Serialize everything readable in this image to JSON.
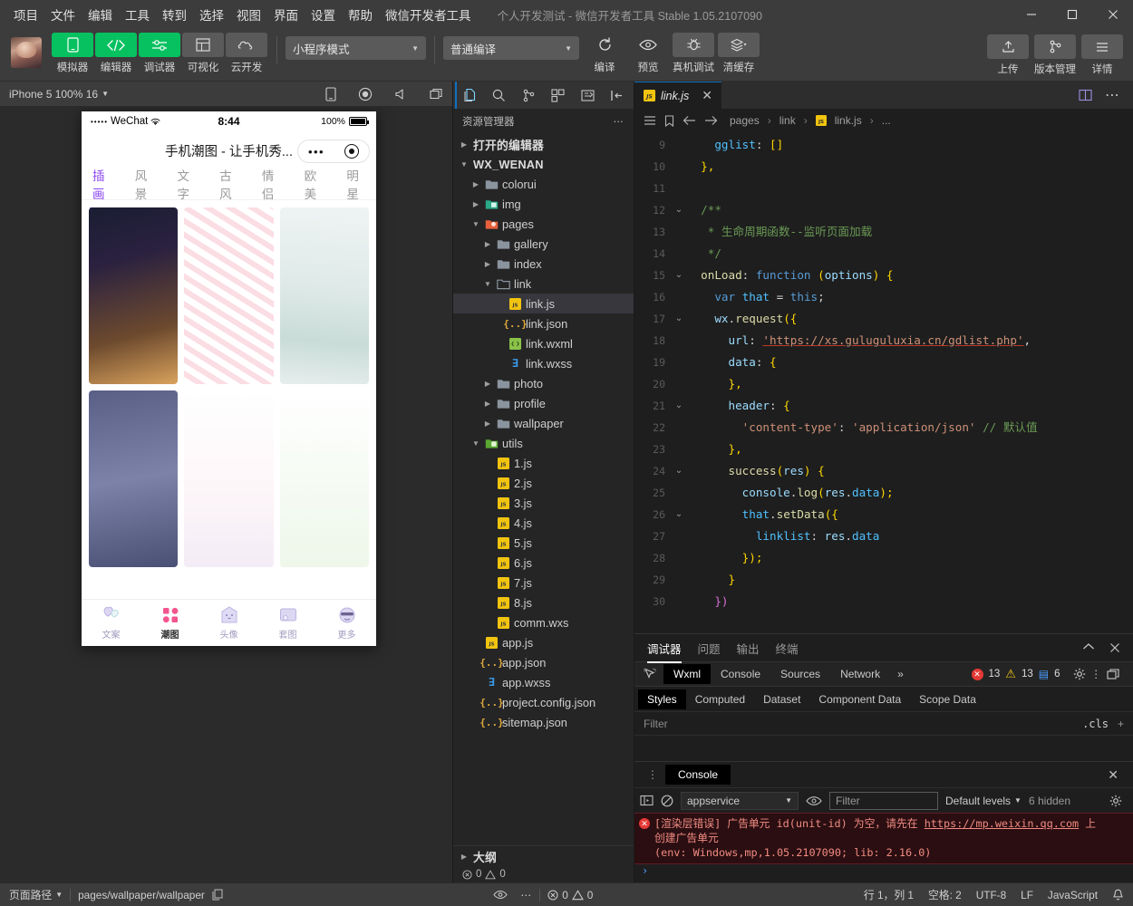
{
  "window": {
    "title": "个人开发测试 - 微信开发者工具 Stable 1.05.2107090",
    "minimize": "—",
    "maximize": "□",
    "close": "✕"
  },
  "menubar": {
    "items": [
      "项目",
      "文件",
      "编辑",
      "工具",
      "转到",
      "选择",
      "视图",
      "界面",
      "设置",
      "帮助",
      "微信开发者工具"
    ]
  },
  "toolbar": {
    "buttons": [
      {
        "label": "模拟器",
        "icon": "phone-icon",
        "accent": true
      },
      {
        "label": "编辑器",
        "icon": "code-icon",
        "accent": true
      },
      {
        "label": "调试器",
        "icon": "sliders-icon",
        "accent": true
      },
      {
        "label": "可视化",
        "icon": "layout-icon",
        "accent": false
      },
      {
        "label": "云开发",
        "icon": "cloud-icon",
        "accent": false
      }
    ],
    "mode_select": "小程序模式",
    "compile_select": "普通编译",
    "actions": [
      {
        "label": "编译",
        "icon": "refresh-icon"
      },
      {
        "label": "预览",
        "icon": "eye-icon"
      },
      {
        "label": "真机调试",
        "icon": "bug-icon"
      },
      {
        "label": "清缓存",
        "icon": "layers-icon"
      }
    ],
    "right_actions": [
      {
        "label": "上传",
        "icon": "upload-icon"
      },
      {
        "label": "版本管理",
        "icon": "branch-icon"
      },
      {
        "label": "详情",
        "icon": "menu-icon"
      }
    ]
  },
  "simulator": {
    "device": "iPhone 5 100% 16",
    "toolbar_icons": [
      "phone-rotate-icon",
      "record-icon",
      "volume-icon",
      "window-icon"
    ],
    "phone": {
      "status": {
        "carrier": "WeChat",
        "signal_dots": "•••••",
        "wifi": "⌃",
        "time": "8:44",
        "battery_pct": "100%"
      },
      "nav_title": "手机潮图 - 让手机秀...",
      "capsule": {
        "more": "•••",
        "target": "◉"
      },
      "categories": [
        "插画",
        "风景",
        "文字",
        "古风",
        "情侣",
        "欧美",
        "明星"
      ],
      "active_category": "插画",
      "tabbar": [
        {
          "label": "文案",
          "icon": "balloon-icon",
          "active": false
        },
        {
          "label": "潮图",
          "icon": "grid-icon",
          "active": true
        },
        {
          "label": "头像",
          "icon": "ghost-icon",
          "active": false
        },
        {
          "label": "套图",
          "icon": "album-icon",
          "active": false
        },
        {
          "label": "更多",
          "icon": "smiley-icon",
          "active": false
        }
      ]
    }
  },
  "explorer": {
    "activity_icons": [
      "files-icon",
      "search-icon",
      "source-control-icon",
      "extensions-icon",
      "wxml-icon",
      "collapse-icon"
    ],
    "title": "资源管理器",
    "more": "⋯",
    "sections": [
      {
        "label": "打开的编辑器",
        "expanded": false,
        "indent": 0,
        "type": "section"
      },
      {
        "label": "WX_WENAN",
        "expanded": true,
        "indent": 0,
        "type": "root"
      }
    ],
    "tree": [
      {
        "name": "colorui",
        "type": "folder",
        "indent": 1,
        "expanded": false
      },
      {
        "name": "img",
        "type": "folder-img",
        "indent": 1,
        "expanded": false
      },
      {
        "name": "pages",
        "type": "folder-pages",
        "indent": 1,
        "expanded": true
      },
      {
        "name": "gallery",
        "type": "folder",
        "indent": 2,
        "expanded": false
      },
      {
        "name": "index",
        "type": "folder",
        "indent": 2,
        "expanded": false
      },
      {
        "name": "link",
        "type": "folder-open",
        "indent": 2,
        "expanded": true
      },
      {
        "name": "link.js",
        "type": "js",
        "indent": 3,
        "selected": true
      },
      {
        "name": "link.json",
        "type": "json",
        "indent": 3
      },
      {
        "name": "link.wxml",
        "type": "wxml",
        "indent": 3
      },
      {
        "name": "link.wxss",
        "type": "wxss",
        "indent": 3
      },
      {
        "name": "photo",
        "type": "folder",
        "indent": 2,
        "expanded": false
      },
      {
        "name": "profile",
        "type": "folder",
        "indent": 2,
        "expanded": false
      },
      {
        "name": "wallpaper",
        "type": "folder",
        "indent": 2,
        "expanded": false
      },
      {
        "name": "utils",
        "type": "folder-utils",
        "indent": 1,
        "expanded": true
      },
      {
        "name": "1.js",
        "type": "js",
        "indent": 2
      },
      {
        "name": "2.js",
        "type": "js",
        "indent": 2
      },
      {
        "name": "3.js",
        "type": "js",
        "indent": 2
      },
      {
        "name": "4.js",
        "type": "js",
        "indent": 2
      },
      {
        "name": "5.js",
        "type": "js",
        "indent": 2
      },
      {
        "name": "6.js",
        "type": "js",
        "indent": 2
      },
      {
        "name": "7.js",
        "type": "js",
        "indent": 2
      },
      {
        "name": "8.js",
        "type": "js",
        "indent": 2
      },
      {
        "name": "comm.wxs",
        "type": "js",
        "indent": 2
      },
      {
        "name": "app.js",
        "type": "js",
        "indent": 1
      },
      {
        "name": "app.json",
        "type": "json",
        "indent": 1
      },
      {
        "name": "app.wxss",
        "type": "wxss",
        "indent": 1
      },
      {
        "name": "project.config.json",
        "type": "json",
        "indent": 1
      },
      {
        "name": "sitemap.json",
        "type": "json",
        "indent": 1
      }
    ],
    "outline": "大纲",
    "problems": {
      "errors": "0",
      "warnings": "0"
    }
  },
  "editor": {
    "tab": {
      "name": "link.js",
      "icon": "js-icon",
      "close": "✕"
    },
    "tab_right_icons": [
      "split-editor-icon",
      "more-actions-icon"
    ],
    "breadcrumb_icons": [
      "outline-icon",
      "bookmark-icon",
      "back-arrow-icon",
      "forward-arrow-icon"
    ],
    "breadcrumb": [
      "pages",
      "link",
      "link.js",
      "..."
    ],
    "first_line_no": 9,
    "lines": [
      {
        "n": 9,
        "fold": "",
        "indent": 2,
        "tokens": [
          {
            "t": "gglist",
            "c": "k-prop"
          },
          {
            "t": ": ",
            "c": "k-pl"
          },
          {
            "t": "[]",
            "c": "k-y"
          }
        ]
      },
      {
        "n": 10,
        "fold": "",
        "indent": 1,
        "tokens": [
          {
            "t": "},",
            "c": "k-y"
          }
        ]
      },
      {
        "n": 11,
        "fold": "",
        "indent": 0,
        "tokens": []
      },
      {
        "n": 12,
        "fold": "v",
        "indent": 1,
        "tokens": [
          {
            "t": "/**",
            "c": "k-com"
          }
        ]
      },
      {
        "n": 13,
        "fold": "",
        "indent": 1,
        "tokens": [
          {
            "t": " * 生命周期函数--监听页面加载",
            "c": "k-com"
          }
        ]
      },
      {
        "n": 14,
        "fold": "",
        "indent": 1,
        "tokens": [
          {
            "t": " */",
            "c": "k-com"
          }
        ]
      },
      {
        "n": 15,
        "fold": "v",
        "indent": 1,
        "tokens": [
          {
            "t": "onLoad",
            "c": "k-fn"
          },
          {
            "t": ": ",
            "c": "k-pl"
          },
          {
            "t": "function ",
            "c": "k-kw"
          },
          {
            "t": "(",
            "c": "k-y"
          },
          {
            "t": "options",
            "c": "k-key"
          },
          {
            "t": ") {",
            "c": "k-y"
          }
        ]
      },
      {
        "n": 16,
        "fold": "",
        "indent": 2,
        "tokens": [
          {
            "t": "var ",
            "c": "k-kw"
          },
          {
            "t": "that",
            "c": "k-prop"
          },
          {
            "t": " = ",
            "c": "k-pl"
          },
          {
            "t": "this",
            "c": "k-kw"
          },
          {
            "t": ";",
            "c": "k-pl"
          }
        ]
      },
      {
        "n": 17,
        "fold": "v",
        "indent": 2,
        "tokens": [
          {
            "t": "wx",
            "c": "k-key"
          },
          {
            "t": ".",
            "c": "k-pl"
          },
          {
            "t": "request",
            "c": "k-fn"
          },
          {
            "t": "({",
            "c": "k-y"
          }
        ]
      },
      {
        "n": 18,
        "fold": "",
        "indent": 3,
        "tokens": [
          {
            "t": "url",
            "c": "k-key"
          },
          {
            "t": ": ",
            "c": "k-pl"
          },
          {
            "t": "'https://xs.guluguluxia.cn/gdlist.php'",
            "c": "k-str ulink"
          },
          {
            "t": ",",
            "c": "k-pl"
          }
        ]
      },
      {
        "n": 19,
        "fold": "",
        "indent": 3,
        "tokens": [
          {
            "t": "data",
            "c": "k-key"
          },
          {
            "t": ": ",
            "c": "k-pl"
          },
          {
            "t": "{",
            "c": "k-y"
          }
        ]
      },
      {
        "n": 20,
        "fold": "",
        "indent": 3,
        "tokens": [
          {
            "t": "},",
            "c": "k-y"
          }
        ]
      },
      {
        "n": 21,
        "fold": "v",
        "indent": 3,
        "tokens": [
          {
            "t": "header",
            "c": "k-key"
          },
          {
            "t": ": ",
            "c": "k-pl"
          },
          {
            "t": "{",
            "c": "k-y"
          }
        ]
      },
      {
        "n": 22,
        "fold": "",
        "indent": 4,
        "tokens": [
          {
            "t": "'content-type'",
            "c": "k-str"
          },
          {
            "t": ": ",
            "c": "k-pl"
          },
          {
            "t": "'application/json'",
            "c": "k-str"
          },
          {
            "t": " // 默认值",
            "c": "k-com"
          }
        ]
      },
      {
        "n": 23,
        "fold": "",
        "indent": 3,
        "tokens": [
          {
            "t": "},",
            "c": "k-y"
          }
        ]
      },
      {
        "n": 24,
        "fold": "v",
        "indent": 3,
        "tokens": [
          {
            "t": "success",
            "c": "k-fn"
          },
          {
            "t": "(",
            "c": "k-y"
          },
          {
            "t": "res",
            "c": "k-key"
          },
          {
            "t": ") {",
            "c": "k-y"
          }
        ]
      },
      {
        "n": 25,
        "fold": "",
        "indent": 4,
        "tokens": [
          {
            "t": "console",
            "c": "k-key"
          },
          {
            "t": ".",
            "c": "k-pl"
          },
          {
            "t": "log",
            "c": "k-fn"
          },
          {
            "t": "(",
            "c": "k-y"
          },
          {
            "t": "res",
            "c": "k-key"
          },
          {
            "t": ".",
            "c": "k-pl"
          },
          {
            "t": "data",
            "c": "k-prop"
          },
          {
            "t": ");",
            "c": "k-y"
          }
        ]
      },
      {
        "n": 26,
        "fold": "v",
        "indent": 4,
        "tokens": [
          {
            "t": "that",
            "c": "k-prop"
          },
          {
            "t": ".",
            "c": "k-pl"
          },
          {
            "t": "setData",
            "c": "k-fn"
          },
          {
            "t": "({",
            "c": "k-y"
          }
        ]
      },
      {
        "n": 27,
        "fold": "",
        "indent": 5,
        "tokens": [
          {
            "t": "linklist",
            "c": "k-prop"
          },
          {
            "t": ": ",
            "c": "k-pl"
          },
          {
            "t": "res",
            "c": "k-key"
          },
          {
            "t": ".",
            "c": "k-pl"
          },
          {
            "t": "data",
            "c": "k-prop"
          }
        ]
      },
      {
        "n": 28,
        "fold": "",
        "indent": 4,
        "tokens": [
          {
            "t": "});",
            "c": "k-y"
          }
        ]
      },
      {
        "n": 29,
        "fold": "",
        "indent": 3,
        "tokens": [
          {
            "t": "}",
            "c": "k-y"
          }
        ]
      },
      {
        "n": 30,
        "fold": "",
        "indent": 2,
        "tokens": [
          {
            "t": "})",
            "c": "k-p"
          }
        ]
      }
    ]
  },
  "debugger": {
    "panel_tabs": [
      "调试器",
      "问题",
      "输出",
      "终端"
    ],
    "active_panel_tab": "调试器",
    "panel_controls": [
      "collapse-icon",
      "close-icon"
    ],
    "devtool_tabs": [
      "Wxml",
      "Console",
      "Sources",
      "Network"
    ],
    "active_devtool_tab": "Wxml",
    "overflow": "»",
    "counts": {
      "errors": "13",
      "warnings": "13",
      "info": "6"
    },
    "right_icons": [
      "settings-gear-icon",
      "more-vertical-icon",
      "dock-icon"
    ],
    "style_tabs": [
      "Styles",
      "Computed",
      "Dataset",
      "Component Data",
      "Scope Data"
    ],
    "active_style_tab": "Styles",
    "filter_placeholder": "Filter",
    "cls_label": ".cls",
    "plus": "+"
  },
  "console": {
    "tab": "Console",
    "close": "✕",
    "context": "appservice",
    "filter_placeholder": "Filter",
    "levels": "Default levels",
    "hidden": "6 hidden",
    "icons": [
      "sidebar-toggle-icon",
      "clear-console-icon",
      "eye-icon",
      "settings-gear-icon"
    ],
    "error": {
      "line1_pre": "[渲染层错误] 广告单元 id(unit-id) 为空，请先在 ",
      "link": "https://mp.weixin.qq.com",
      "line1_post": " 上",
      "line2": "创建广告单元",
      "line3": "(env: Windows,mp,1.05.2107090; lib: 2.16.0)"
    },
    "prompt": "›"
  },
  "statusbar": {
    "page_path_label": "页面路径",
    "page_path": "pages/wallpaper/wallpaper",
    "copy_icon": "copy-icon",
    "eye_icon": "eye-icon",
    "more": "⋯",
    "errors": "0",
    "warnings": "0",
    "cursor": "行 1，列 1",
    "indent": "空格: 2",
    "encoding": "UTF-8",
    "eol": "LF",
    "language": "JavaScript",
    "bell_icon": "bell-icon"
  },
  "colors": {
    "accent_green": "#07c160",
    "purple": "#8b46f0",
    "error_red": "#e53935",
    "warn_yellow": "#f0c419",
    "info_blue": "#4a9eff",
    "js_yellow": "#f1c40f",
    "editor_bg": "#1e1e1e",
    "chrome_bg": "#3c3c3c"
  }
}
